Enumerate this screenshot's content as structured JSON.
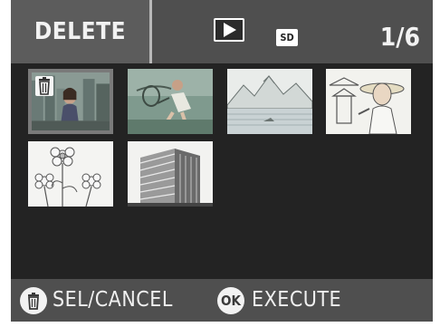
{
  "header": {
    "mode_label": "DELETE",
    "play_icon": "play-icon",
    "storage_icon": "sd-card-icon",
    "storage_label": "SD",
    "frame_counter": "1/6"
  },
  "thumbnails": [
    {
      "subject": "woman-in-city",
      "selected": true,
      "marked_for_delete": true
    },
    {
      "subject": "tennis-player",
      "selected": false
    },
    {
      "subject": "mountain-lake",
      "selected": false
    },
    {
      "subject": "woman-with-hat-pagoda",
      "selected": false
    },
    {
      "subject": "flowers",
      "selected": false
    },
    {
      "subject": "office-building",
      "selected": false
    }
  ],
  "footer": {
    "sel_cancel_icon": "trash-icon",
    "sel_cancel_label": "SEL/CANCEL",
    "execute_icon_label": "OK",
    "execute_label": "EXECUTE"
  },
  "colors": {
    "bar": "#4f4f4f",
    "background": "#232323",
    "text": "#f2f2f2",
    "selection": "#7a7a7a"
  }
}
